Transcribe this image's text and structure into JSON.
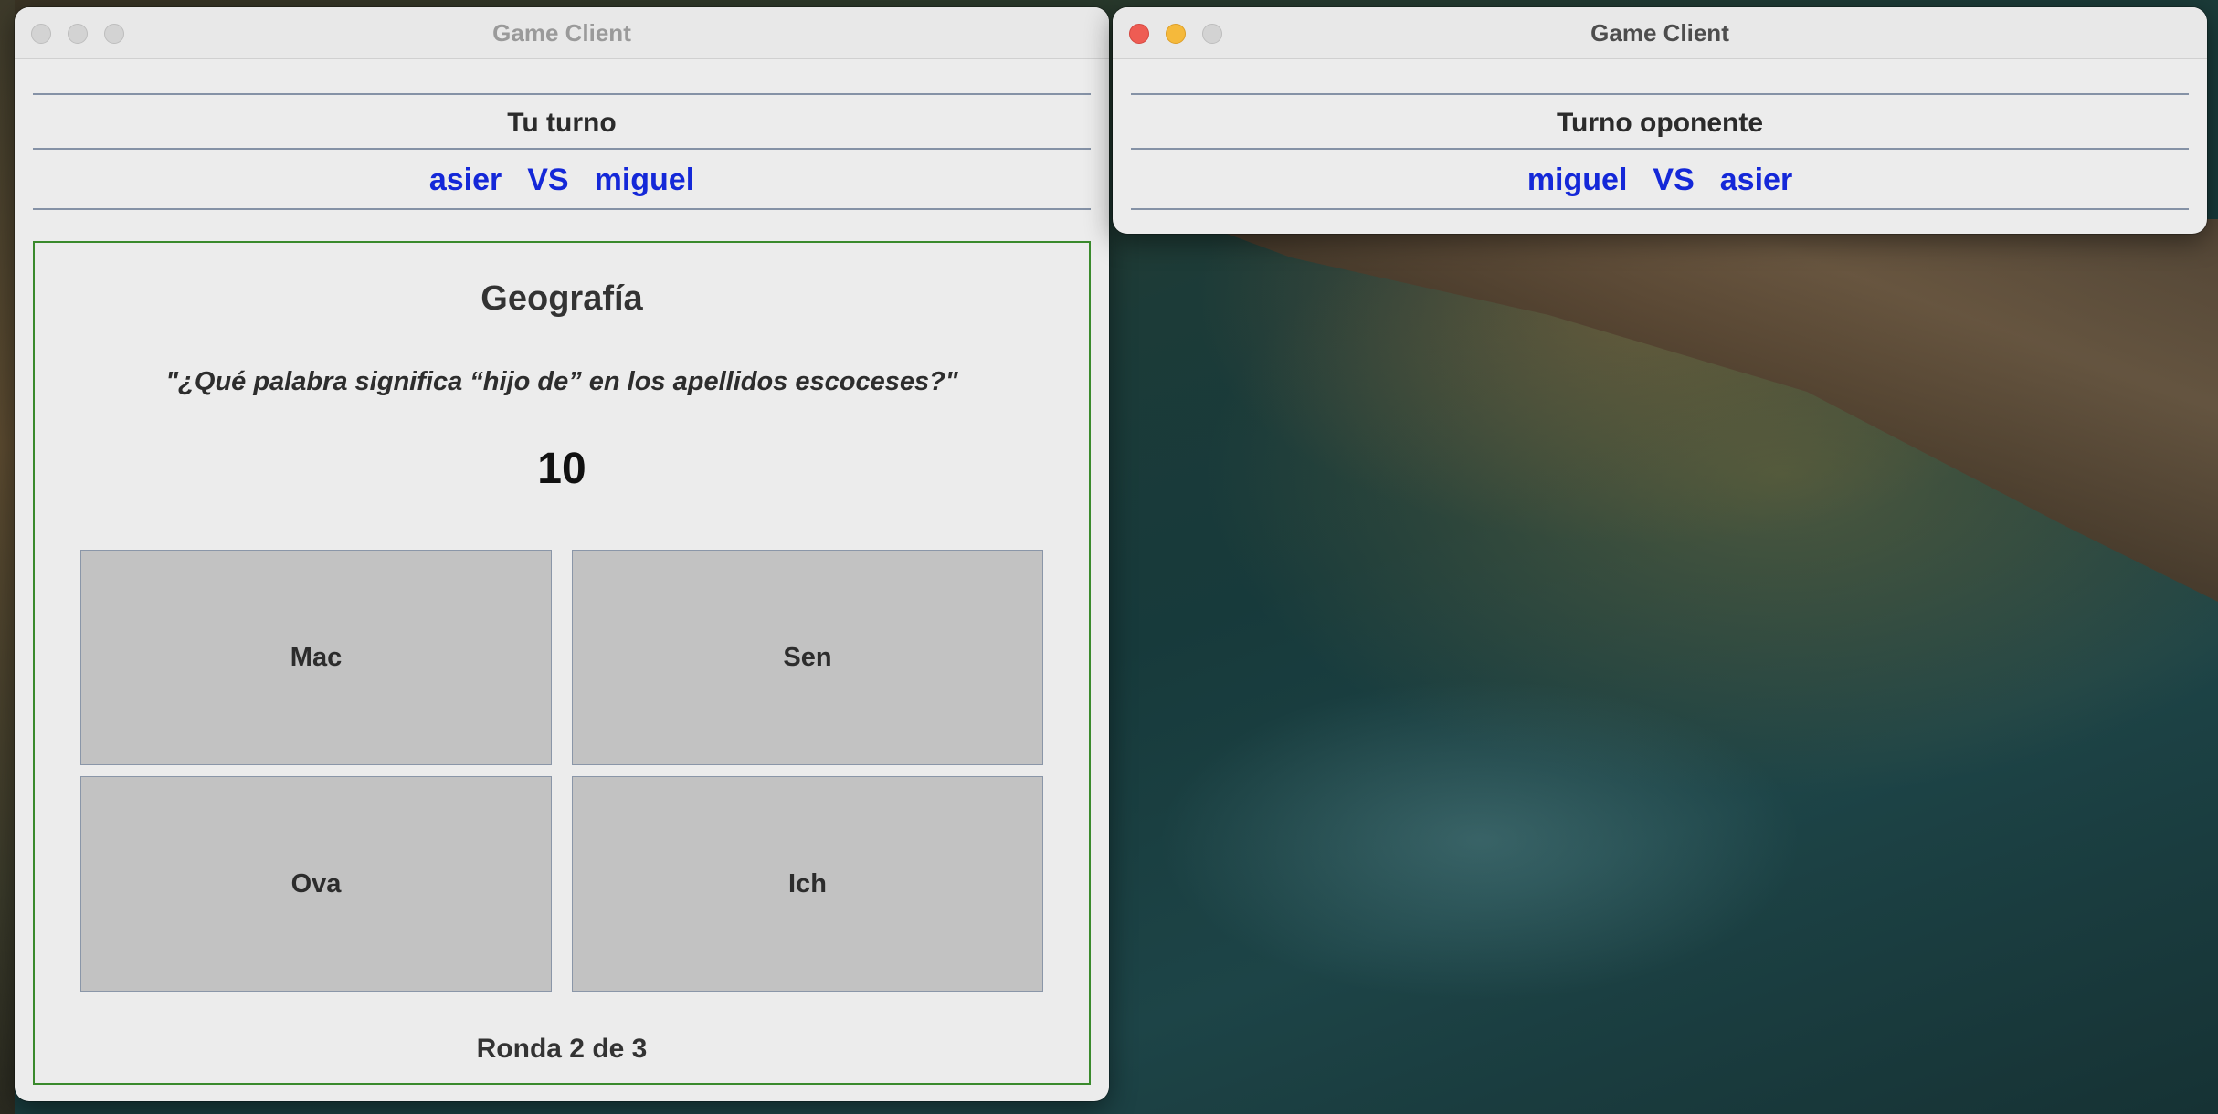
{
  "left_window": {
    "title": "Game Client",
    "turn_status": "Tu turno",
    "player_one": "asier",
    "vs_label": "VS",
    "player_two": "miguel",
    "category": "Geografía",
    "question": "\"¿Qué palabra significa “hijo de” en los apellidos escoceses?\"",
    "timer": "10",
    "answers": [
      "Mac",
      "Sen",
      "Ova",
      "Ich"
    ],
    "round_label": "Ronda 2 de 3"
  },
  "right_window": {
    "title": "Game Client",
    "turn_status": "Turno oponente",
    "player_one": "miguel",
    "vs_label": "VS",
    "player_two": "asier"
  },
  "colors": {
    "player_names": "#1428d8",
    "panel_border": "#3a8a2c",
    "answer_button_bg": "#c2c2c2",
    "close_red": "#ee5c53",
    "minimize_yellow": "#f5b93b"
  }
}
